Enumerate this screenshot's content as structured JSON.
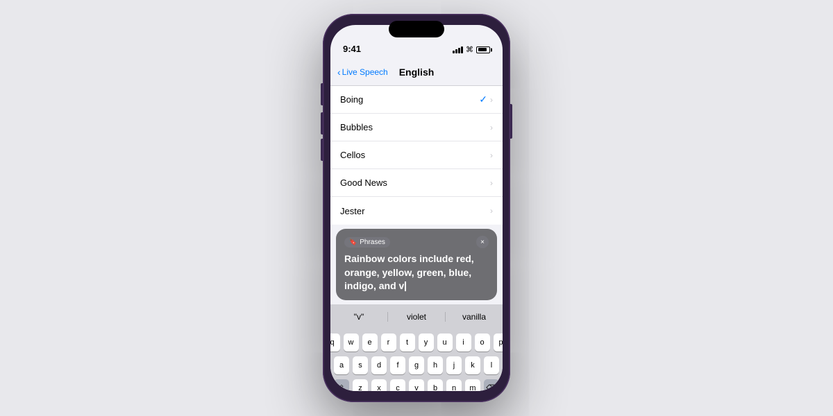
{
  "background_color": "#e8e8ec",
  "phone": {
    "status_bar": {
      "time": "9:41",
      "signal_label": "signal",
      "wifi_label": "wifi",
      "battery_label": "battery"
    },
    "nav": {
      "back_label": "Live Speech",
      "title": "English"
    },
    "settings_items": [
      {
        "label": "Boing",
        "checked": true
      },
      {
        "label": "Bubbles",
        "checked": false
      },
      {
        "label": "Cellos",
        "checked": false
      },
      {
        "label": "Good News",
        "checked": false
      },
      {
        "label": "Jester",
        "checked": false
      }
    ],
    "phrases": {
      "badge_label": "Phrases",
      "text": "Rainbow colors include red, orange, yellow, green, blue, indigo, and v",
      "close_label": "×"
    },
    "autocomplete": {
      "items": [
        "\"v\"",
        "violet",
        "vanilla"
      ]
    },
    "keyboard": {
      "rows": [
        [
          "q",
          "w",
          "e",
          "r",
          "t",
          "y",
          "u",
          "i",
          "o",
          "p"
        ],
        [
          "a",
          "s",
          "d",
          "f",
          "g",
          "h",
          "j",
          "k",
          "l"
        ],
        [
          "z",
          "x",
          "c",
          "v",
          "b",
          "n",
          "m"
        ]
      ]
    }
  }
}
